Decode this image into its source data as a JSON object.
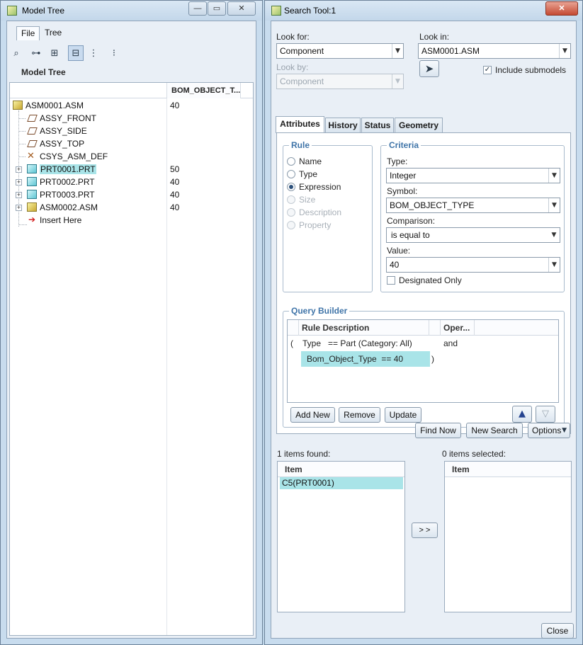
{
  "model_tree_window": {
    "title": "Model Tree",
    "caption_buttons": {
      "minimize": "—",
      "restore": "▭",
      "close": "✕"
    },
    "menu": {
      "file": "File",
      "tree": "Tree"
    },
    "heading": "Model Tree",
    "column_header": "BOM_OBJECT_T...",
    "items": [
      {
        "label": "ASM0001.ASM",
        "icon": "assembly-icon",
        "value": "40"
      },
      {
        "label": "ASSY_FRONT",
        "icon": "datum-plane-icon",
        "value": ""
      },
      {
        "label": "ASSY_SIDE",
        "icon": "datum-plane-icon",
        "value": ""
      },
      {
        "label": "ASSY_TOP",
        "icon": "datum-plane-icon",
        "value": ""
      },
      {
        "label": "CSYS_ASM_DEF",
        "icon": "coordinate-system-icon",
        "value": ""
      },
      {
        "label": "PRT0001.PRT",
        "icon": "part-icon",
        "value": "50",
        "selected": true
      },
      {
        "label": "PRT0002.PRT",
        "icon": "part-icon",
        "value": "40"
      },
      {
        "label": "PRT0003.PRT",
        "icon": "part-icon",
        "value": "40"
      },
      {
        "label": "ASM0002.ASM",
        "icon": "assembly-icon",
        "value": "40"
      },
      {
        "label": "Insert Here",
        "icon": "insert-arrow-icon",
        "value": ""
      }
    ]
  },
  "search_tool_window": {
    "title": "Search Tool:1",
    "caption_buttons": {
      "close": "✕"
    },
    "look_for": {
      "label": "Look for:",
      "value": "Component"
    },
    "look_in": {
      "label": "Look in:",
      "value": "ASM0001.ASM"
    },
    "look_by": {
      "label": "Look by:",
      "value": "Component"
    },
    "include_submodels": {
      "label": "Include submodels",
      "checked": true
    },
    "tabs": [
      "Attributes",
      "History",
      "Status",
      "Geometry"
    ],
    "rule": {
      "legend": "Rule",
      "options": [
        {
          "label": "Name",
          "enabled": true
        },
        {
          "label": "Type",
          "enabled": true
        },
        {
          "label": "Expression",
          "enabled": true,
          "selected": true
        },
        {
          "label": "Size",
          "enabled": false
        },
        {
          "label": "Description",
          "enabled": false
        },
        {
          "label": "Property",
          "enabled": false
        }
      ]
    },
    "criteria": {
      "legend": "Criteria",
      "type_label": "Type:",
      "type_value": "Integer",
      "symbol_label": "Symbol:",
      "symbol_value": "BOM_OBJECT_TYPE",
      "comparison_label": "Comparison:",
      "comparison_value": "is equal to",
      "value_label": "Value:",
      "value_value": "40",
      "designated_only": {
        "label": "Designated Only",
        "checked": false
      }
    },
    "query_builder": {
      "legend": "Query Builder",
      "columns": [
        "Rule Description",
        "Oper..."
      ],
      "rows": [
        {
          "open_paren": "(",
          "description": "Type   == Part (Category: All)",
          "operator": "and"
        },
        {
          "description": "Bom_Object_Type  == 40",
          "close_paren": ")"
        }
      ],
      "buttons": {
        "add_new": "Add New",
        "remove": "Remove",
        "update": "Update"
      }
    },
    "actions": {
      "find_now": "Find Now",
      "new_search": "New Search",
      "options": "Options"
    },
    "results": {
      "found_label": "1 items found:",
      "found_column": "Item",
      "found_items": [
        "C5(PRT0001)"
      ],
      "transfer_button": "> >",
      "selected_label": "0 items selected:",
      "selected_column": "Item",
      "selected_items": []
    },
    "close_button": "Close"
  }
}
